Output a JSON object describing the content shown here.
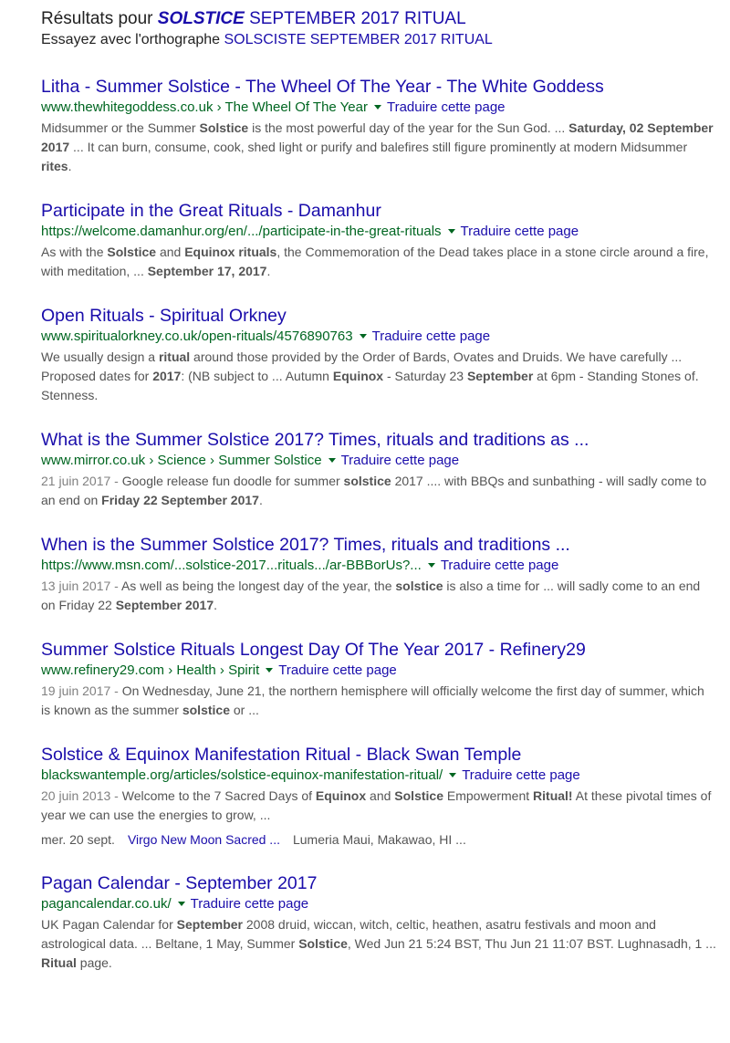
{
  "spelling": {
    "prefix": "Résultats pour ",
    "query_italic": "SOLSTICE",
    "query_rest": " SEPTEMBER 2017 RITUAL",
    "try_prefix": "Essayez avec l'orthographe ",
    "try_alt": "SOLSCISTE SEPTEMBER 2017 RITUAL"
  },
  "translate_label": "Traduire cette page",
  "results": [
    {
      "title": "Litha - Summer Solstice - The Wheel Of The Year - The White Goddess",
      "url": "www.thewhitegoddess.co.uk › The Wheel Of The Year",
      "snippet": [
        {
          "t": "Midsummer or the Summer "
        },
        {
          "b": "Solstice"
        },
        {
          "t": " is the most powerful day of the year for the Sun God. ... "
        },
        {
          "b": "Saturday, 02 September 2017"
        },
        {
          "t": " ... It can burn, consume, cook, shed light or purify and balefires still figure prominently at modern Midsummer "
        },
        {
          "b": "rites"
        },
        {
          "t": "."
        }
      ]
    },
    {
      "title": "Participate in the Great Rituals - Damanhur",
      "url": "https://welcome.damanhur.org/en/.../participate-in-the-great-rituals",
      "snippet": [
        {
          "t": "As with the "
        },
        {
          "b": "Solstice"
        },
        {
          "t": " and "
        },
        {
          "b": "Equinox rituals"
        },
        {
          "t": ", the Commemoration of the Dead takes place in a stone circle around a fire, with meditation, ... "
        },
        {
          "b": "September 17, 2017"
        },
        {
          "t": "."
        }
      ]
    },
    {
      "title": "Open Rituals - Spiritual Orkney",
      "url": "www.spiritualorkney.co.uk/open-rituals/4576890763",
      "snippet": [
        {
          "t": "We usually design a "
        },
        {
          "b": "ritual"
        },
        {
          "t": " around those provided by the Order of Bards, Ovates and Druids. We have carefully ... Proposed dates for "
        },
        {
          "b": "2017"
        },
        {
          "t": ": (NB subject to ... Autumn "
        },
        {
          "b": "Equinox"
        },
        {
          "t": " - Saturday 23 "
        },
        {
          "b": "September"
        },
        {
          "t": " at 6pm - Standing Stones of. Stenness."
        }
      ]
    },
    {
      "title": "What is the Summer Solstice 2017? Times, rituals and traditions as ...",
      "url": "www.mirror.co.uk › Science › Summer Solstice",
      "snippet": [
        {
          "d": "21 juin 2017 - "
        },
        {
          "t": "Google release fun doodle for summer "
        },
        {
          "b": "solstice"
        },
        {
          "t": " 2017 .... with BBQs and sunbathing - will sadly come to an end on "
        },
        {
          "b": "Friday 22 September 2017"
        },
        {
          "t": "."
        }
      ]
    },
    {
      "title": "When is the Summer Solstice 2017? Times, rituals and traditions ...",
      "url": "https://www.msn.com/...solstice-2017...rituals.../ar-BBBorUs?...",
      "snippet": [
        {
          "d": "13 juin 2017 - "
        },
        {
          "t": "As well as being the longest day of the year, the "
        },
        {
          "b": "solstice"
        },
        {
          "t": " is also a time for ... will sadly come to an end on Friday 22 "
        },
        {
          "b": "September 2017"
        },
        {
          "t": "."
        }
      ]
    },
    {
      "title": "Summer Solstice Rituals Longest Day Of The Year 2017 - Refinery29",
      "url": "www.refinery29.com › Health › Spirit",
      "snippet": [
        {
          "d": "19 juin 2017 - "
        },
        {
          "t": "On Wednesday, June 21, the northern hemisphere will officially welcome the first day of summer, which is known as the summer "
        },
        {
          "b": "solstice"
        },
        {
          "t": " or ..."
        }
      ]
    },
    {
      "title": "Solstice & Equinox Manifestation Ritual - Black Swan Temple",
      "url": "blackswantemple.org/articles/solstice-equinox-manifestation-ritual/",
      "snippet": [
        {
          "d": "20 juin 2013 - "
        },
        {
          "t": "Welcome to the 7 Sacred Days of "
        },
        {
          "b": "Equinox"
        },
        {
          "t": " and "
        },
        {
          "b": "Solstice"
        },
        {
          "t": " Empowerment "
        },
        {
          "b": "Ritual!"
        },
        {
          "t": " At these pivotal times of year we can use the energies to grow, ..."
        }
      ],
      "events": {
        "date": "mer. 20 sept.",
        "link": "Virgo New Moon Sacred ...",
        "place": "Lumeria Maui, Makawao, HI ..."
      }
    },
    {
      "title": "Pagan Calendar - September 2017",
      "url": "pagancalendar.co.uk/",
      "snippet": [
        {
          "t": "UK Pagan Calendar for "
        },
        {
          "b": "September"
        },
        {
          "t": " 2008 druid, wiccan, witch, celtic, heathen, asatru festivals and moon and astrological data. ... Beltane, 1 May, Summer "
        },
        {
          "b": "Solstice"
        },
        {
          "t": ", Wed Jun 21 5:24 BST, Thu Jun 21 11:07 BST. Lughnasadh, 1 ... "
        },
        {
          "b": "Ritual"
        },
        {
          "t": " page."
        }
      ]
    }
  ]
}
